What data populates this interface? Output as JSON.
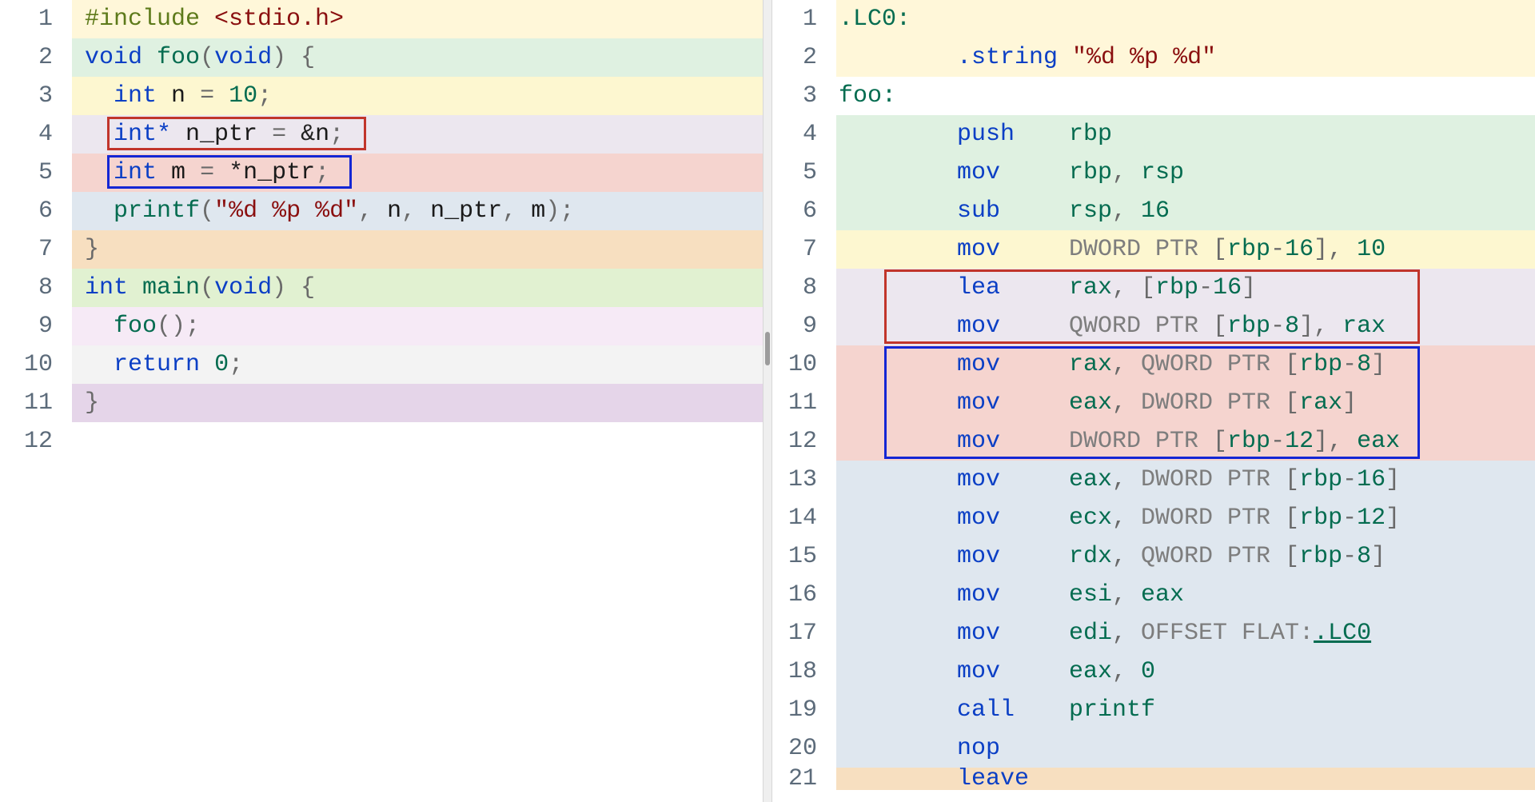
{
  "source": {
    "lines": [
      {
        "num": 1,
        "bg": "bg-cream",
        "tokens": [
          [
            "tk-pre",
            "#include "
          ],
          [
            "tk-hdr",
            "<stdio.h>"
          ]
        ]
      },
      {
        "num": 2,
        "bg": "bg-lgreen",
        "tokens": [
          [
            "tk-type",
            "void"
          ],
          [
            "",
            " "
          ],
          [
            "tk-func",
            "foo"
          ],
          [
            "tk-pun",
            "("
          ],
          [
            "tk-type",
            "void"
          ],
          [
            "tk-pun",
            ")"
          ],
          [
            "",
            " "
          ],
          [
            "tk-pun",
            "{"
          ]
        ]
      },
      {
        "num": 3,
        "bg": "bg-lyellow",
        "tokens": [
          [
            "indent",
            "  "
          ],
          [
            "tk-type",
            "int"
          ],
          [
            "",
            " "
          ],
          [
            "tk-id",
            "n"
          ],
          [
            "",
            " "
          ],
          [
            "tk-op",
            "="
          ],
          [
            "",
            " "
          ],
          [
            "tk-num",
            "10"
          ],
          [
            "tk-pun",
            ";"
          ]
        ]
      },
      {
        "num": 4,
        "bg": "bg-lav",
        "tokens": [
          [
            "indent",
            "  "
          ],
          [
            "tk-type",
            "int*"
          ],
          [
            "",
            " "
          ],
          [
            "tk-id",
            "n_ptr"
          ],
          [
            "",
            " "
          ],
          [
            "tk-op",
            "="
          ],
          [
            "",
            " &"
          ],
          [
            "tk-id",
            "n"
          ],
          [
            "tk-pun",
            ";"
          ]
        ],
        "box": "red"
      },
      {
        "num": 5,
        "bg": "bg-salmon",
        "tokens": [
          [
            "indent",
            "  "
          ],
          [
            "tk-type",
            "int"
          ],
          [
            "",
            " "
          ],
          [
            "tk-id",
            "m"
          ],
          [
            "",
            " "
          ],
          [
            "tk-op",
            "="
          ],
          [
            "",
            " *"
          ],
          [
            "tk-id",
            "n_ptr"
          ],
          [
            "tk-pun",
            ";"
          ]
        ],
        "box": "blue"
      },
      {
        "num": 6,
        "bg": "bg-lblue",
        "tokens": [
          [
            "indent",
            "  "
          ],
          [
            "tk-func",
            "printf"
          ],
          [
            "tk-pun",
            "("
          ],
          [
            "tk-str",
            "\"%d %p %d\""
          ],
          [
            "tk-pun",
            ","
          ],
          [
            "",
            " "
          ],
          [
            "tk-id",
            "n"
          ],
          [
            "tk-pun",
            ","
          ],
          [
            "",
            " "
          ],
          [
            "tk-id",
            "n_ptr"
          ],
          [
            "tk-pun",
            ","
          ],
          [
            "",
            " "
          ],
          [
            "tk-id",
            "m"
          ],
          [
            "tk-pun",
            ")"
          ],
          [
            "tk-pun",
            ";"
          ]
        ]
      },
      {
        "num": 7,
        "bg": "bg-peach",
        "tokens": [
          [
            "tk-pun",
            "}"
          ]
        ]
      },
      {
        "num": 8,
        "bg": "bg-mint",
        "tokens": [
          [
            "tk-type",
            "int"
          ],
          [
            "",
            " "
          ],
          [
            "tk-func",
            "main"
          ],
          [
            "tk-pun",
            "("
          ],
          [
            "tk-type",
            "void"
          ],
          [
            "tk-pun",
            ")"
          ],
          [
            "",
            " "
          ],
          [
            "tk-pun",
            "{"
          ]
        ]
      },
      {
        "num": 9,
        "bg": "bg-pink",
        "tokens": [
          [
            "indent",
            "  "
          ],
          [
            "tk-func",
            "foo"
          ],
          [
            "tk-pun",
            "()"
          ],
          [
            "tk-pun",
            ";"
          ]
        ]
      },
      {
        "num": 10,
        "bg": "bg-grey",
        "tokens": [
          [
            "indent",
            "  "
          ],
          [
            "tk-kw",
            "return"
          ],
          [
            "",
            " "
          ],
          [
            "tk-num",
            "0"
          ],
          [
            "tk-pun",
            ";"
          ]
        ]
      },
      {
        "num": 11,
        "bg": "bg-plum",
        "tokens": [
          [
            "tk-pun",
            "}"
          ]
        ]
      },
      {
        "num": 12,
        "bg": "bg-white",
        "tokens": []
      }
    ]
  },
  "asm": {
    "lines": [
      {
        "num": 1,
        "bg": "bg-cream",
        "label": ".LC0:"
      },
      {
        "num": 2,
        "bg": "bg-cream",
        "dir": ".string",
        "args": [
          [
            "tk-str",
            "\"%d %p %d\""
          ]
        ]
      },
      {
        "num": 3,
        "bg": "bg-white",
        "label": "foo:"
      },
      {
        "num": 4,
        "bg": "bg-lgreen",
        "mn": "push",
        "args": [
          [
            "tk-reg",
            "rbp"
          ]
        ]
      },
      {
        "num": 5,
        "bg": "bg-lgreen",
        "mn": "mov",
        "args": [
          [
            "tk-reg",
            "rbp"
          ],
          [
            "tk-pun",
            ", "
          ],
          [
            "tk-reg",
            "rsp"
          ]
        ]
      },
      {
        "num": 6,
        "bg": "bg-lgreen",
        "mn": "sub",
        "args": [
          [
            "tk-reg",
            "rsp"
          ],
          [
            "tk-pun",
            ", "
          ],
          [
            "tk-num",
            "16"
          ]
        ]
      },
      {
        "num": 7,
        "bg": "bg-lyellow",
        "mn": "mov",
        "args": [
          [
            "tk-mem",
            "DWORD PTR "
          ],
          [
            "tk-pun",
            "["
          ],
          [
            "tk-reg",
            "rbp"
          ],
          [
            "tk-op",
            "-"
          ],
          [
            "tk-num",
            "16"
          ],
          [
            "tk-pun",
            "]"
          ],
          [
            "tk-pun",
            ", "
          ],
          [
            "tk-num",
            "10"
          ]
        ]
      },
      {
        "num": 8,
        "bg": "bg-lav",
        "mn": "lea",
        "args": [
          [
            "tk-reg",
            "rax"
          ],
          [
            "tk-pun",
            ", "
          ],
          [
            "tk-pun",
            "["
          ],
          [
            "tk-reg",
            "rbp"
          ],
          [
            "tk-op",
            "-"
          ],
          [
            "tk-num",
            "16"
          ],
          [
            "tk-pun",
            "]"
          ]
        ],
        "box": "red"
      },
      {
        "num": 9,
        "bg": "bg-lav",
        "mn": "mov",
        "args": [
          [
            "tk-mem",
            "QWORD PTR "
          ],
          [
            "tk-pun",
            "["
          ],
          [
            "tk-reg",
            "rbp"
          ],
          [
            "tk-op",
            "-"
          ],
          [
            "tk-num",
            "8"
          ],
          [
            "tk-pun",
            "]"
          ],
          [
            "tk-pun",
            ", "
          ],
          [
            "tk-reg",
            "rax"
          ]
        ],
        "box": "red"
      },
      {
        "num": 10,
        "bg": "bg-salmon",
        "mn": "mov",
        "args": [
          [
            "tk-reg",
            "rax"
          ],
          [
            "tk-pun",
            ", "
          ],
          [
            "tk-mem",
            "QWORD PTR "
          ],
          [
            "tk-pun",
            "["
          ],
          [
            "tk-reg",
            "rbp"
          ],
          [
            "tk-op",
            "-"
          ],
          [
            "tk-num",
            "8"
          ],
          [
            "tk-pun",
            "]"
          ]
        ],
        "box": "blue"
      },
      {
        "num": 11,
        "bg": "bg-salmon",
        "mn": "mov",
        "args": [
          [
            "tk-reg",
            "eax"
          ],
          [
            "tk-pun",
            ", "
          ],
          [
            "tk-mem",
            "DWORD PTR "
          ],
          [
            "tk-pun",
            "["
          ],
          [
            "tk-reg",
            "rax"
          ],
          [
            "tk-pun",
            "]"
          ]
        ],
        "box": "blue"
      },
      {
        "num": 12,
        "bg": "bg-salmon",
        "mn": "mov",
        "args": [
          [
            "tk-mem",
            "DWORD PTR "
          ],
          [
            "tk-pun",
            "["
          ],
          [
            "tk-reg",
            "rbp"
          ],
          [
            "tk-op",
            "-"
          ],
          [
            "tk-num",
            "12"
          ],
          [
            "tk-pun",
            "]"
          ],
          [
            "tk-pun",
            ", "
          ],
          [
            "tk-reg",
            "eax"
          ]
        ],
        "box": "blue"
      },
      {
        "num": 13,
        "bg": "bg-lblue",
        "mn": "mov",
        "args": [
          [
            "tk-reg",
            "eax"
          ],
          [
            "tk-pun",
            ", "
          ],
          [
            "tk-mem",
            "DWORD PTR "
          ],
          [
            "tk-pun",
            "["
          ],
          [
            "tk-reg",
            "rbp"
          ],
          [
            "tk-op",
            "-"
          ],
          [
            "tk-num",
            "16"
          ],
          [
            "tk-pun",
            "]"
          ]
        ]
      },
      {
        "num": 14,
        "bg": "bg-lblue",
        "mn": "mov",
        "args": [
          [
            "tk-reg",
            "ecx"
          ],
          [
            "tk-pun",
            ", "
          ],
          [
            "tk-mem",
            "DWORD PTR "
          ],
          [
            "tk-pun",
            "["
          ],
          [
            "tk-reg",
            "rbp"
          ],
          [
            "tk-op",
            "-"
          ],
          [
            "tk-num",
            "12"
          ],
          [
            "tk-pun",
            "]"
          ]
        ]
      },
      {
        "num": 15,
        "bg": "bg-lblue",
        "mn": "mov",
        "args": [
          [
            "tk-reg",
            "rdx"
          ],
          [
            "tk-pun",
            ", "
          ],
          [
            "tk-mem",
            "QWORD PTR "
          ],
          [
            "tk-pun",
            "["
          ],
          [
            "tk-reg",
            "rbp"
          ],
          [
            "tk-op",
            "-"
          ],
          [
            "tk-num",
            "8"
          ],
          [
            "tk-pun",
            "]"
          ]
        ]
      },
      {
        "num": 16,
        "bg": "bg-lblue",
        "mn": "mov",
        "args": [
          [
            "tk-reg",
            "esi"
          ],
          [
            "tk-pun",
            ", "
          ],
          [
            "tk-reg",
            "eax"
          ]
        ]
      },
      {
        "num": 17,
        "bg": "bg-lblue",
        "mn": "mov",
        "args": [
          [
            "tk-reg",
            "edi"
          ],
          [
            "tk-pun",
            ", "
          ],
          [
            "tk-mem",
            "OFFSET FLAT:"
          ],
          [
            "tk-link",
            ".LC0"
          ]
        ]
      },
      {
        "num": 18,
        "bg": "bg-lblue",
        "mn": "mov",
        "args": [
          [
            "tk-reg",
            "eax"
          ],
          [
            "tk-pun",
            ", "
          ],
          [
            "tk-num",
            "0"
          ]
        ]
      },
      {
        "num": 19,
        "bg": "bg-lblue",
        "mn": "call",
        "args": [
          [
            "tk-func",
            "printf"
          ]
        ]
      },
      {
        "num": 20,
        "bg": "bg-lblue",
        "mn": "nop",
        "args": []
      },
      {
        "num": 21,
        "bg": "bg-peach",
        "mn": "leave",
        "args": [],
        "cut": true
      }
    ]
  }
}
